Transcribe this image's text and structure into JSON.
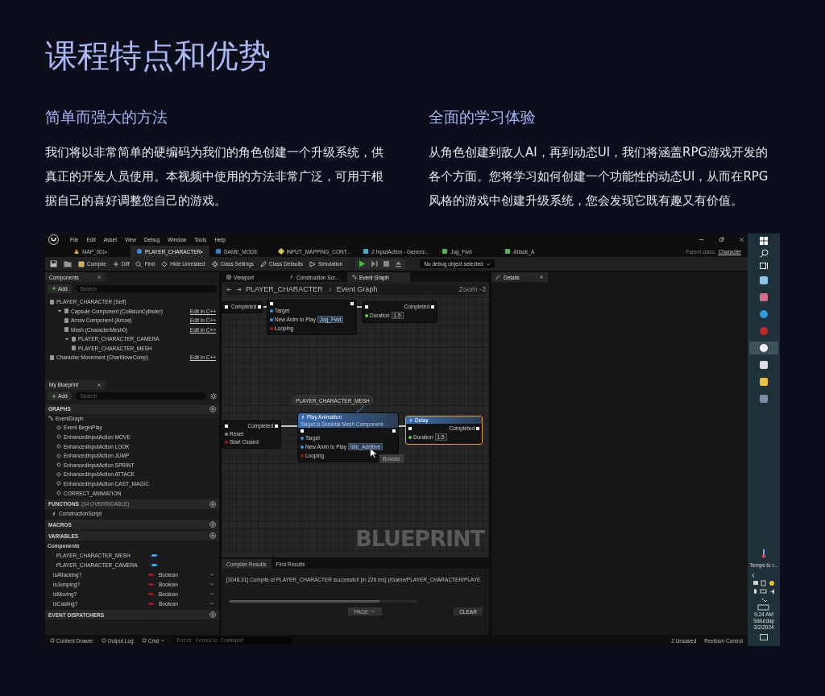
{
  "title": "课程特点和优势",
  "features": [
    {
      "heading": "简单而强大的方法",
      "body": "我们将以非常简单的硬编码为我们的角色创建一个升级系统，供真正的开发人员使用。本视频中使用的方法非常广泛，可用于根据自己的喜好调整您自己的游戏。"
    },
    {
      "heading": "全面的学习体验",
      "body": "从角色创建到敌人AI，再到动态UI，我们将涵盖RPG游戏开发的各个方面。您将学习如何创建一个功能性的动态UI，从而在RPG风格的游戏中创建升级系统，您会发现它既有趣又有价值。"
    }
  ],
  "editor": {
    "menu": [
      "File",
      "Edit",
      "Asset",
      "View",
      "Debug",
      "Window",
      "Tools",
      "Help"
    ],
    "tabs": [
      {
        "label": "MAP_001•",
        "kind": "map",
        "selected": false
      },
      {
        "label": "PLAYER_CHARACTER•",
        "kind": "character",
        "selected": true
      },
      {
        "label": "GAME_MODE",
        "kind": "blueprint",
        "selected": false
      },
      {
        "label": "INPUT_MAPPING_CONT...",
        "kind": "mapping",
        "selected": false
      },
      {
        "label": "2 InputAction - Generic...",
        "kind": "action",
        "selected": false
      },
      {
        "label": "Jog_Fwd",
        "kind": "anim",
        "selected": false
      },
      {
        "label": "Attack_A",
        "kind": "anim",
        "selected": false
      }
    ],
    "parent_class_label": "Parent class:",
    "parent_class": "Character",
    "toolbar": [
      {
        "kind": "save"
      },
      {
        "kind": "browse"
      },
      {
        "kind": "compile",
        "label": "Compile"
      },
      {
        "kind": "diff",
        "label": "Diff"
      },
      {
        "kind": "find",
        "label": "Find"
      },
      {
        "kind": "hide",
        "label": "Hide Unrelated"
      },
      {
        "kind": "settings",
        "label": "Class Settings"
      },
      {
        "kind": "defaults",
        "label": "Class Defaults"
      },
      {
        "kind": "simulation",
        "label": "Simulation"
      },
      {
        "kind": "play"
      }
    ],
    "debug_select": "No debug object selected",
    "components": {
      "title": "Components",
      "add": "Add",
      "search_placeholder": "Search",
      "items": [
        {
          "label": "PLAYER_CHARACTER (Self)",
          "children": [
            {
              "label": "Capsule Component (CollisionCylinder)",
              "action": "Edit in C++",
              "expanded": true,
              "children": [
                {
                  "label": "Arrow Component (Arrow)",
                  "action": "Edit in C++"
                },
                {
                  "label": "Mesh (CharacterMesh0)",
                  "action": "Edit in C++"
                },
                {
                  "label": "PLAYER_CHARACTER_CAMERA",
                  "expanded": true,
                  "children": [
                    {
                      "label": "PLAYER_CHARACTER_MESH"
                    }
                  ]
                }
              ]
            }
          ]
        },
        {
          "label": "Character Movement (CharMoveComp)",
          "action": "Edit in C++"
        }
      ]
    },
    "my_blueprint": {
      "title": "My Blueprint",
      "add": "Add",
      "search_placeholder": "Search",
      "graphs": {
        "title": "GRAPHS",
        "root": "EventGraph",
        "items": [
          "Event BeginPlay",
          "EnhancedInputAction MOVE",
          "EnhancedInputAction LOOK",
          "EnhancedInputAction JUMP",
          "EnhancedInputAction SPRINT",
          "EnhancedInputAction ATTACK",
          "EnhancedInputAction CAST_MAGIC",
          "CORRECT_ANIMATION"
        ]
      },
      "functions": {
        "title": "FUNCTIONS",
        "note": "(34 OVERRIDABLE)",
        "items": [
          "ConstructionScript"
        ]
      },
      "macros": {
        "title": "MACROS"
      },
      "variables": {
        "title": "VARIABLES",
        "group": "Components",
        "components": [
          {
            "label": "PLAYER_CHARACTER_MESH",
            "color": "#3aa6ee"
          },
          {
            "label": "PLAYER_CHARACTER_CAMERA",
            "color": "#3aa6ee"
          }
        ],
        "items": [
          {
            "label": "isAttacking?",
            "type": "Boolean",
            "color": "#a11a1a"
          },
          {
            "label": "isJumping?",
            "type": "Boolean",
            "color": "#a11a1a"
          },
          {
            "label": "isMoving?",
            "type": "Boolean",
            "color": "#a11a1a"
          },
          {
            "label": "isCasting?",
            "type": "Boolean",
            "color": "#a11a1a"
          }
        ]
      },
      "dispatchers": {
        "title": "EVENT DISPATCHERS"
      }
    },
    "graph_tabs": [
      {
        "label": "Viewport",
        "kind": "viewport",
        "selected": false
      },
      {
        "label": "Construction Scr...",
        "kind": "function",
        "selected": false
      },
      {
        "label": "Event Graph",
        "kind": "graph",
        "selected": true
      }
    ],
    "breadcrumb": {
      "root": "PLAYER_CHARACTER",
      "current": "Event Graph"
    },
    "zoom": "Zoom -3",
    "nodes": [
      {
        "selected": false,
        "rows": [
          {
            "kind": "exec",
            "right": "Completed"
          }
        ]
      },
      {
        "selected": false,
        "rows": [
          {
            "kind": "exec"
          },
          {
            "kind": "object",
            "left": "Target"
          },
          {
            "kind": "asset",
            "left": "New Anim to Play",
            "value": "Jog_Fwd"
          },
          {
            "kind": "bool",
            "left": "Looping"
          }
        ]
      },
      {
        "selected": false,
        "rows": [
          {
            "kind": "exec",
            "right": "Completed"
          },
          {
            "kind": "float",
            "left": "Duration",
            "value": "1.5"
          }
        ]
      },
      {
        "selected": false,
        "rows": [
          {
            "kind": "exec",
            "right": "Completed"
          },
          {
            "kind": "plain",
            "left": "Reset"
          },
          {
            "kind": "bool",
            "left": "Start Closed"
          }
        ]
      },
      {
        "selected": false,
        "title": "Play Animation",
        "subtitle": "Target is Skeletal Mesh Component",
        "rows": [
          {
            "kind": "exec"
          },
          {
            "kind": "object",
            "left": "Target"
          },
          {
            "kind": "asset",
            "left": "New Anim to Play",
            "value": "Idle_Additive"
          },
          {
            "kind": "bool",
            "left": "Looping"
          }
        ]
      },
      {
        "selected": true,
        "title": "Delay",
        "rows": [
          {
            "kind": "exec",
            "right": "Completed"
          },
          {
            "kind": "float",
            "left": "Duration",
            "value": "1.5"
          }
        ]
      }
    ],
    "mesh_pill": "PLAYER_CHARACTER_MESH",
    "tooltip": "Browse",
    "graph_label": "BLUEPRINT",
    "results": {
      "tabs": [
        "Compiler Results",
        "Find Results"
      ],
      "log": "[3048.31] Compile of PLAYER_CHARACTER successful! [in 226 ms] (/Game/PLAYER_CHARACTER/PLAYE",
      "page": "PAGE",
      "clear": "CLEAR"
    },
    "details": "Details",
    "status": {
      "left": [
        "Content Drawer",
        "Output Log"
      ],
      "cmd": "Cmd",
      "console_placeholder": "Enter Console Command",
      "right": [
        "2 Unsaved",
        "Revision Control"
      ]
    }
  },
  "taskbar": {
    "apps": [
      {
        "kind": "notes",
        "selected": false
      },
      {
        "kind": "paint",
        "selected": false
      },
      {
        "kind": "edge",
        "selected": false
      },
      {
        "kind": "obs",
        "selected": false
      },
      {
        "kind": "unreal",
        "selected": true
      },
      {
        "kind": "epic",
        "selected": false
      },
      {
        "kind": "folder",
        "selected": false
      },
      {
        "kind": "calc",
        "selected": false
      }
    ],
    "weather": "Temps to r...",
    "time": "9:24 AM",
    "day": "Saturday",
    "date": "3/2/2024"
  }
}
